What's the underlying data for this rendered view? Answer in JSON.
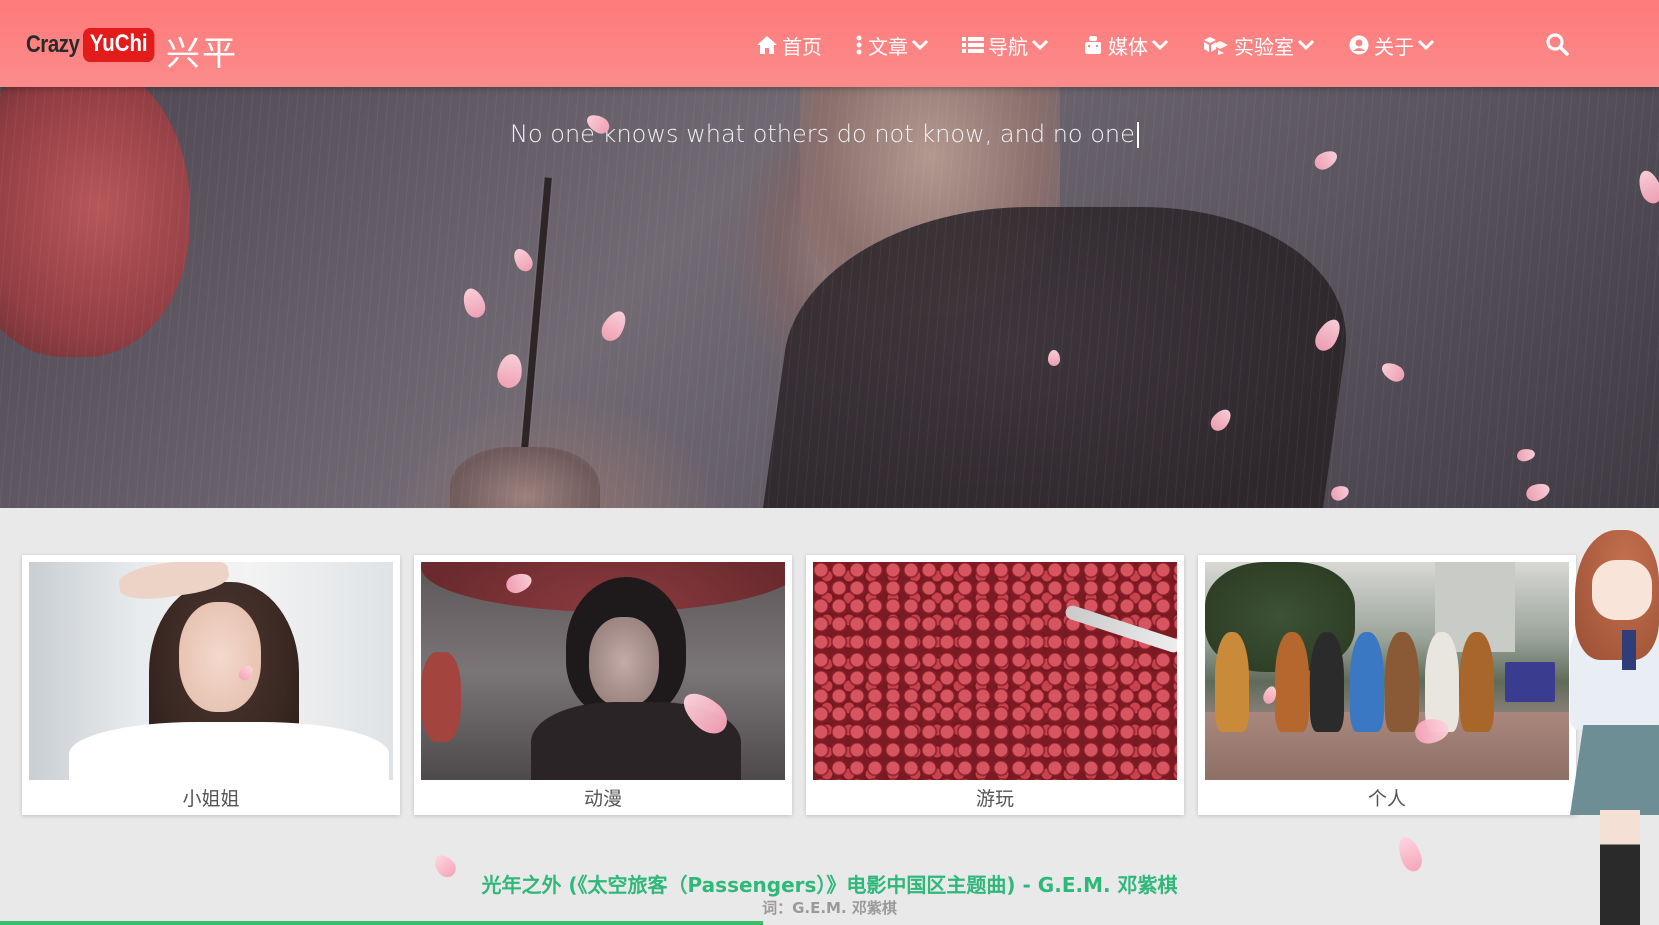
{
  "header": {
    "logo": {
      "crazy": "Crazy",
      "yuchi": "YuChi"
    },
    "site_name": "兴平",
    "nav": [
      {
        "label": "首页",
        "icon": "home-icon",
        "has_dropdown": false
      },
      {
        "label": "文章",
        "icon": "ellipsis-vertical-icon",
        "has_dropdown": true
      },
      {
        "label": "导航",
        "icon": "list-icon",
        "has_dropdown": true
      },
      {
        "label": "媒体",
        "icon": "media-icon",
        "has_dropdown": true
      },
      {
        "label": "实验室",
        "icon": "cubes-icon",
        "has_dropdown": true
      },
      {
        "label": "关于",
        "icon": "user-circle-icon",
        "has_dropdown": true
      }
    ],
    "search_icon": "search-icon",
    "bg_color": "#fb8585"
  },
  "hero": {
    "quote": "No one knows what others do not know, and no one"
  },
  "categories": [
    {
      "label": "小姐姐"
    },
    {
      "label": "动漫"
    },
    {
      "label": "游玩"
    },
    {
      "label": "个人"
    }
  ],
  "music": {
    "title": "光年之外 (《太空旅客（Passengers）》电影中国区主题曲) - G.E.M. 邓紫棋",
    "lyric": "词：G.E.M. 邓紫棋",
    "progress_percent": 46,
    "accent_color": "#2fb87a"
  }
}
